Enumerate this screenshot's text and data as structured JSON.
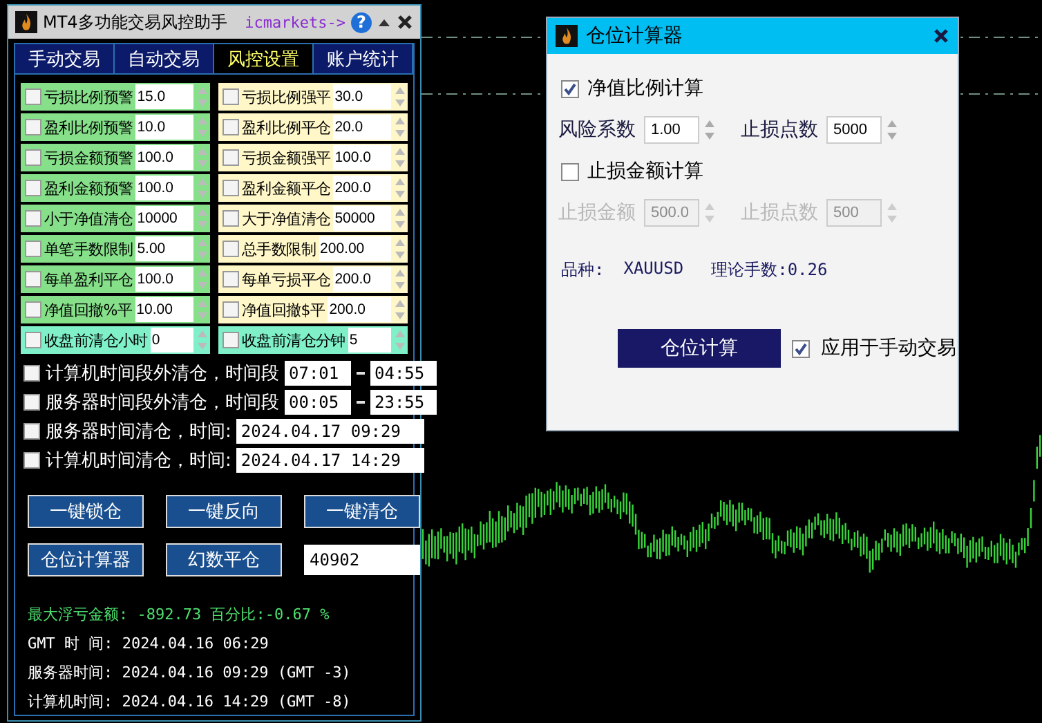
{
  "main_window": {
    "title": "MT4多功能交易风控助手",
    "broker_link": "icmarkets->",
    "help": "?"
  },
  "tabs": [
    {
      "label": "手动交易",
      "selected": false
    },
    {
      "label": "自动交易",
      "selected": false
    },
    {
      "label": "风控设置",
      "selected": true
    },
    {
      "label": "账户统计",
      "selected": false
    }
  ],
  "risk_rules": [
    {
      "label": "亏损比例预警",
      "value": "15.0",
      "checked": false,
      "color": "#86e08a"
    },
    {
      "label": "亏损比例强平",
      "value": "30.0",
      "checked": false,
      "color": "#fff7c8"
    },
    {
      "label": "盈利比例预警",
      "value": "10.0",
      "checked": false,
      "color": "#86e08a"
    },
    {
      "label": "盈利比例平仓",
      "value": "20.0",
      "checked": false,
      "color": "#fff7c8"
    },
    {
      "label": "亏损金额预警",
      "value": "100.0",
      "checked": false,
      "color": "#86e08a"
    },
    {
      "label": "亏损金额强平",
      "value": "100.0",
      "checked": false,
      "color": "#fff7c8"
    },
    {
      "label": "盈利金额预警",
      "value": "100.0",
      "checked": false,
      "color": "#86e08a"
    },
    {
      "label": "盈利金额平仓",
      "value": "200.0",
      "checked": false,
      "color": "#fff7c8"
    },
    {
      "label": "小于净值清仓",
      "value": "10000",
      "checked": false,
      "color": "#86e08a"
    },
    {
      "label": "大于净值清仓",
      "value": "50000",
      "checked": false,
      "color": "#fff7c8"
    },
    {
      "label": "单笔手数限制",
      "value": "5.00",
      "checked": false,
      "color": "#86e08a"
    },
    {
      "label": "总手数限制",
      "value": "200.00",
      "checked": false,
      "color": "#fff7c8"
    },
    {
      "label": "每单盈利平仓",
      "value": "100.0",
      "checked": false,
      "color": "#86e08a"
    },
    {
      "label": "每单亏损平仓",
      "value": "200.0",
      "checked": false,
      "color": "#fff7c8"
    },
    {
      "label": "净值回撤%平",
      "value": "10.00",
      "checked": false,
      "color": "#86e08a"
    },
    {
      "label": "净值回撤$平",
      "value": "200.0",
      "checked": false,
      "color": "#fff7c8"
    },
    {
      "label": "收盘前清仓小时",
      "value": "0",
      "checked": false,
      "color": "#7ff0c8"
    },
    {
      "label": "收盘前清仓分钟",
      "value": "5",
      "checked": false,
      "color": "#7ff0c8"
    }
  ],
  "time_rules": [
    {
      "kind": "range",
      "label": "计算机时间段外清仓，时间段",
      "checked": false,
      "from": "07:01",
      "to": "04:55"
    },
    {
      "kind": "range",
      "label": "服务器时间段外清仓，时间段",
      "checked": false,
      "from": "00:05",
      "to": "23:55"
    },
    {
      "kind": "datetime",
      "label": "服务器时间清仓，时间:",
      "checked": false,
      "value": "2024.04.17 09:29"
    },
    {
      "kind": "datetime",
      "label": "计算机时间清仓，时间:",
      "checked": false,
      "value": "2024.04.17 14:29"
    }
  ],
  "actions": [
    {
      "kind": "button",
      "label": "一键锁仓"
    },
    {
      "kind": "button",
      "label": "一键反向"
    },
    {
      "kind": "button",
      "label": "一键清仓"
    },
    {
      "kind": "button",
      "label": "仓位计算器"
    },
    {
      "kind": "button",
      "label": "幻数平仓"
    },
    {
      "kind": "field",
      "value": "40902"
    }
  ],
  "summary": {
    "max_loss": "最大浮亏金额: -892.73 百分比:-0.67 %",
    "times": [
      "GMT 时 间: 2024.04.16 06:29",
      "服务器时间: 2024.04.16 09:29 (GMT -3)",
      "计算机时间: 2024.04.16 14:29 (GMT -8)"
    ]
  },
  "calculator": {
    "title": "仓位计算器",
    "sections": [
      {
        "kind": "checkbox",
        "label": "净值比例计算",
        "checked": true
      },
      {
        "kind": "fields",
        "disabled": false,
        "fields": [
          {
            "label": "风险系数",
            "value": "1.00"
          },
          {
            "label": "止损点数",
            "value": "5000"
          }
        ]
      },
      {
        "kind": "checkbox",
        "label": "止损金额计算",
        "checked": false
      },
      {
        "kind": "fields",
        "disabled": true,
        "fields": [
          {
            "label": "止损金额",
            "value": "500.0"
          },
          {
            "label": "止损点数",
            "value": "500"
          }
        ]
      }
    ],
    "symbol_label": "品种:",
    "symbol": "XAUUSD",
    "lots": "理论手数:0.26",
    "calc_button": "仓位计算",
    "apply_manual": {
      "label": "应用于手动交易",
      "checked": true
    }
  }
}
